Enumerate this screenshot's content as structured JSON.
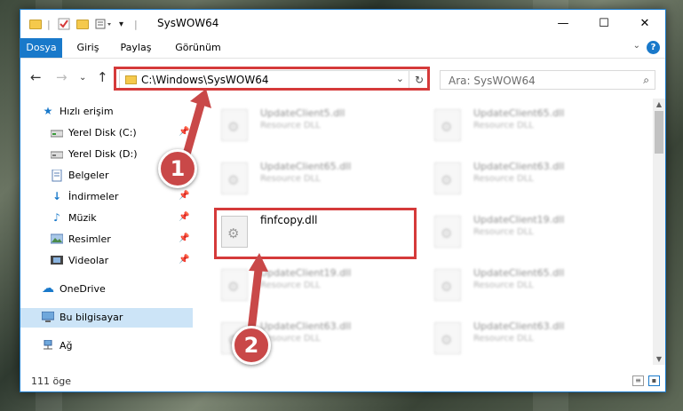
{
  "window": {
    "title": "SysWOW64",
    "controls": {
      "minimize": "—",
      "maximize": "☐",
      "close": "✕"
    }
  },
  "ribbon": {
    "tabs": [
      {
        "label": "Dosya",
        "active": true
      },
      {
        "label": "Giriş",
        "active": false
      },
      {
        "label": "Paylaş",
        "active": false
      },
      {
        "label": "Görünüm",
        "active": false
      }
    ],
    "help": "?"
  },
  "navbar": {
    "address": "C:\\Windows\\SysWOW64",
    "search_placeholder": "Ara: SysWOW64"
  },
  "sidebar": {
    "items": [
      {
        "label": "Hızlı erişim",
        "icon": "star-icon"
      },
      {
        "label": "Yerel Disk (C:)",
        "icon": "drive-icon",
        "pinned": true
      },
      {
        "label": "Yerel Disk (D:)",
        "icon": "drive-icon"
      },
      {
        "label": "Belgeler",
        "icon": "document-icon",
        "pinned": true
      },
      {
        "label": "İndirmeler",
        "icon": "download-icon",
        "pinned": true
      },
      {
        "label": "Müzik",
        "icon": "music-icon",
        "pinned": true
      },
      {
        "label": "Resimler",
        "icon": "picture-icon",
        "pinned": true
      },
      {
        "label": "Videolar",
        "icon": "video-icon",
        "pinned": true
      },
      {
        "label": "OneDrive",
        "icon": "cloud-icon"
      },
      {
        "label": "Bu bilgisayar",
        "icon": "computer-icon",
        "selected": true
      },
      {
        "label": "Ağ",
        "icon": "network-icon"
      }
    ]
  },
  "files": {
    "left": [
      {
        "name": "UpdateClient5.dll",
        "desc": "Resource DLL"
      },
      {
        "name": "UpdateClient65.dll",
        "desc": "Resource DLL"
      },
      {
        "name": "finfcopy.dll",
        "desc": ""
      },
      {
        "name": "UpdateClient19.dll",
        "desc": "Resource DLL"
      },
      {
        "name": "UpdateClient63.dll",
        "desc": "Resource DLL"
      }
    ],
    "right": [
      {
        "name": "UpdateClient65.dll",
        "desc": "Resource DLL"
      },
      {
        "name": "UpdateClient63.dll",
        "desc": "Resource DLL"
      },
      {
        "name": "UpdateClient19.dll",
        "desc": "Resource DLL"
      },
      {
        "name": "UpdateClient65.dll",
        "desc": "Resource DLL"
      },
      {
        "name": "UpdateClient63.dll",
        "desc": "Resource DLL"
      }
    ]
  },
  "status": {
    "count": "111 öge"
  },
  "callouts": {
    "one": "1",
    "two": "2"
  },
  "colors": {
    "accent": "#1979ca",
    "highlight": "#d53a3a",
    "callout": "#c94848"
  }
}
